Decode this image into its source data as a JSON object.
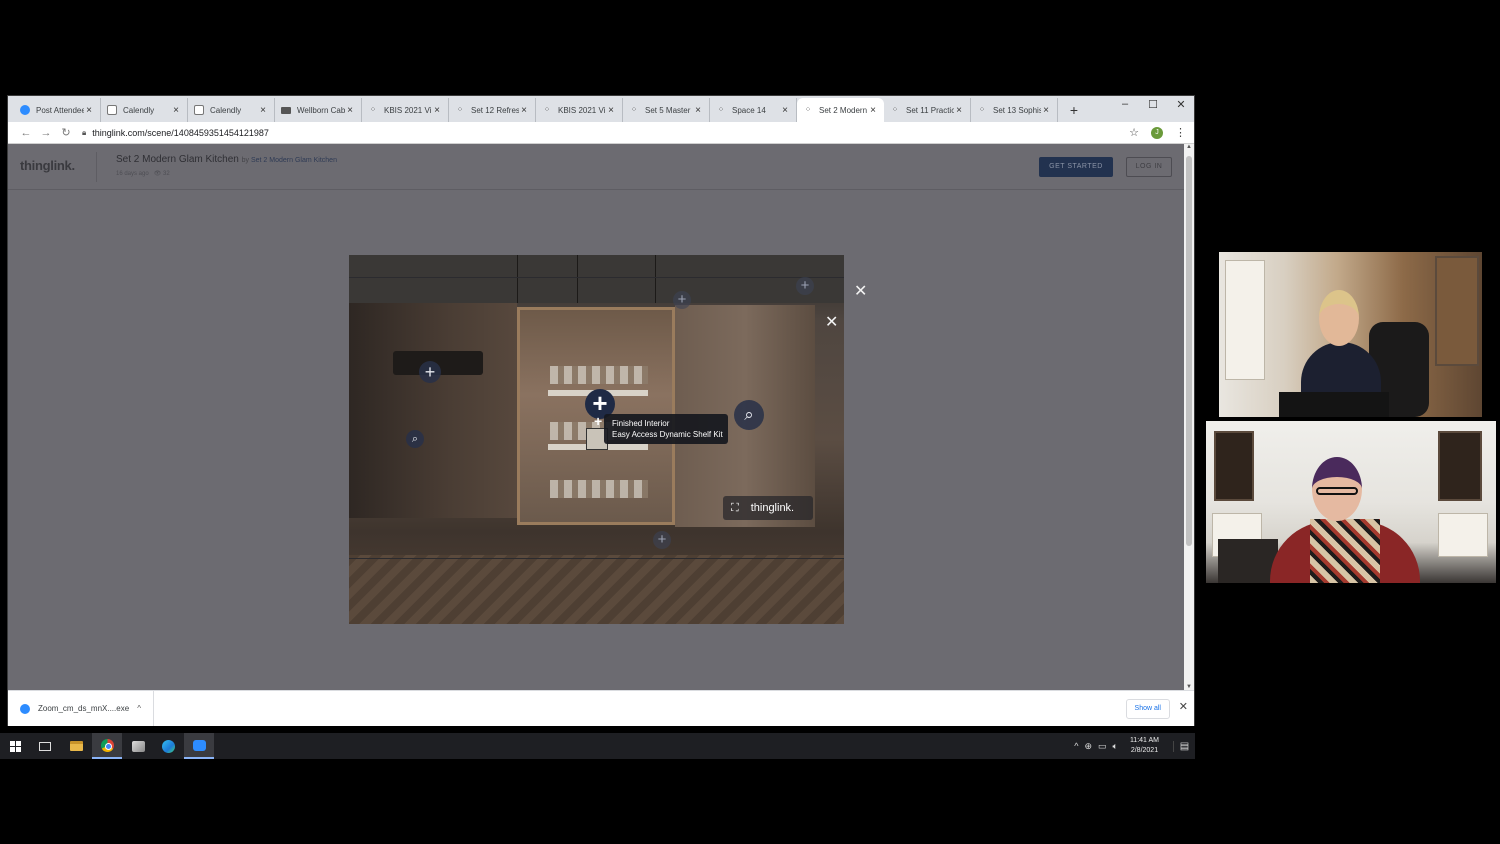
{
  "browser": {
    "tabs": [
      {
        "label": "Post Attendee",
        "icon": "zoom-icon",
        "active": false
      },
      {
        "label": "Calendly",
        "icon": "calendly-icon",
        "active": false
      },
      {
        "label": "Calendly",
        "icon": "calendly-icon",
        "active": false
      },
      {
        "label": "Wellborn Cab",
        "icon": "wellborn-icon",
        "active": false
      },
      {
        "label": "KBIS 2021 Vir",
        "icon": "thinglink-icon",
        "active": false
      },
      {
        "label": "Set 12 Refres",
        "icon": "thinglink-icon",
        "active": false
      },
      {
        "label": "KBIS 2021 Vir",
        "icon": "thinglink-icon",
        "active": false
      },
      {
        "label": "Set 5 Master",
        "icon": "thinglink-icon",
        "active": false
      },
      {
        "label": "Space 14",
        "icon": "thinglink-icon",
        "active": false
      },
      {
        "label": "Set 2 Modern",
        "icon": "thinglink-icon",
        "active": true
      },
      {
        "label": "Set 11 Practic",
        "icon": "thinglink-icon",
        "active": false
      },
      {
        "label": "Set 13 Sophis",
        "icon": "thinglink-icon",
        "active": false
      }
    ],
    "new_tab": "+",
    "window_controls": {
      "minimize": "–",
      "maximize": "☐",
      "close": "✕"
    },
    "url": "thinglink.com/scene/1408459351454121987",
    "profile_initial": "J"
  },
  "site": {
    "logo": "thinglink.",
    "scene_title": "Set 2 Modern Glam Kitchen",
    "by_prefix": "by",
    "by_author": "Set 2 Modern Glam Kitchen",
    "meta_age": "16 days ago",
    "meta_views": "32",
    "get_started": "GET STARTED",
    "log_in": "LOG IN"
  },
  "viewer": {
    "tooltip_title": "Finished Interior",
    "tooltip_subtitle": "Easy Access Dynamic Shelf Kit",
    "brand": "thinglink."
  },
  "downloads": {
    "file": "Zoom_cm_ds_mnX....exe",
    "show_all": "Show all"
  },
  "taskbar": {
    "time": "11:41 AM",
    "date": "2/8/2021"
  },
  "colors": {
    "accent_button": "#22324f",
    "page_overlay": "#6c6b71",
    "zoom_blue": "#2d8cff"
  }
}
